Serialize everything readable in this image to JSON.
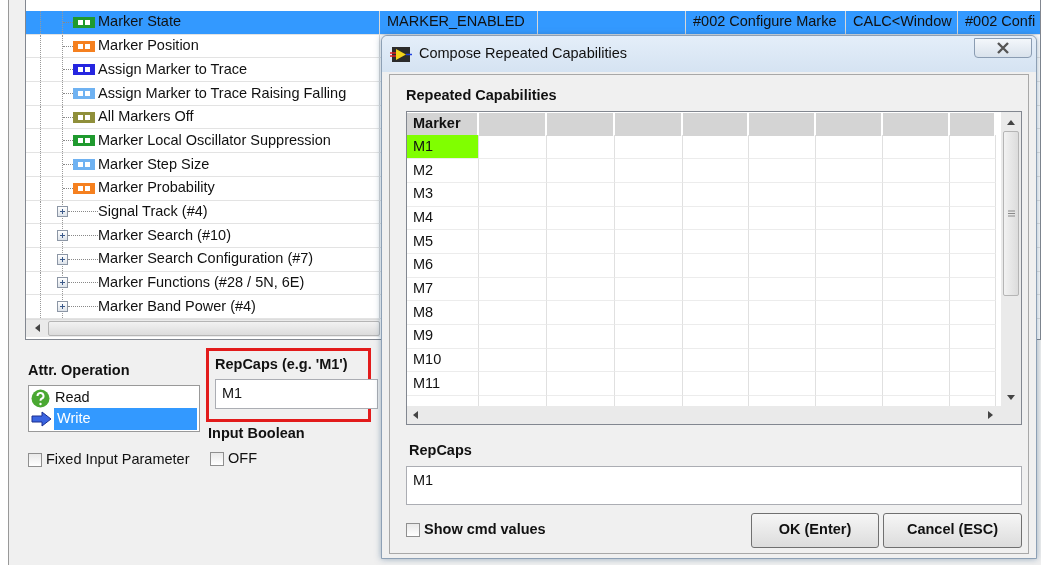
{
  "main": {
    "tree_rows": [
      {
        "label": "Marker State",
        "kind": "leaf",
        "color": "#1f9a2e",
        "selected": true,
        "cells": {
          "column_2": "MARKER_ENABLED",
          "column_4": "#002 Configure Marke",
          "column_5": "CALC<Window",
          "column_6": "#002 Confi"
        }
      },
      {
        "label": "Marker Position",
        "kind": "leaf",
        "color": "#f5801f",
        "selected": false
      },
      {
        "label": "Assign Marker to Trace",
        "kind": "leaf",
        "color": "#2626e0",
        "selected": false
      },
      {
        "label": "Assign Marker to Trace Raising Falling",
        "kind": "leaf",
        "color": "#6fb2f2",
        "selected": false
      },
      {
        "label": "All Markers Off",
        "kind": "leaf",
        "color": "#8f8f3a",
        "selected": false
      },
      {
        "label": "Marker Local Oscillator Suppression",
        "kind": "leaf",
        "color": "#1f9a2e",
        "selected": false
      },
      {
        "label": "Marker Step Size",
        "kind": "leaf",
        "color": "#6fb2f2",
        "selected": false
      },
      {
        "label": "Marker Probability",
        "kind": "leaf",
        "color": "#f5801f",
        "selected": false
      },
      {
        "label": "Signal Track (#4)",
        "kind": "group",
        "expanded": false,
        "selected": false
      },
      {
        "label": "Marker Search (#10)",
        "kind": "group",
        "expanded": false,
        "selected": false
      },
      {
        "label": "Marker Search Configuration (#7)",
        "kind": "group",
        "expanded": false,
        "selected": false
      },
      {
        "label": "Marker Functions (#28 / 5N, 6E)",
        "kind": "group",
        "expanded": false,
        "selected": false
      },
      {
        "label": "Marker Band Power (#4)",
        "kind": "group",
        "expanded": false,
        "selected": false
      }
    ],
    "attr_operation": {
      "label": "Attr. Operation",
      "items": [
        {
          "label": "Read",
          "kind": "read",
          "selected": false
        },
        {
          "label": "Write",
          "kind": "write",
          "selected": true
        }
      ]
    },
    "fixed_input": {
      "label": "Fixed Input Parameter",
      "checked": false
    },
    "repcaps": {
      "label": "RepCaps (e.g. 'M1')",
      "value": "M1"
    },
    "input_boolean": {
      "label": "Input Boolean",
      "checkbox_label": "OFF",
      "checked": false
    }
  },
  "dialog": {
    "title": "Compose Repeated Capabilities",
    "group_label": "Repeated Capabilities",
    "grid": {
      "column": "Marker",
      "rows": [
        {
          "label": "M1",
          "selected": true
        },
        {
          "label": "M2",
          "selected": false
        },
        {
          "label": "M3",
          "selected": false
        },
        {
          "label": "M4",
          "selected": false
        },
        {
          "label": "M5",
          "selected": false
        },
        {
          "label": "M6",
          "selected": false
        },
        {
          "label": "M7",
          "selected": false
        },
        {
          "label": "M8",
          "selected": false
        },
        {
          "label": "M9",
          "selected": false
        },
        {
          "label": "M10",
          "selected": false
        },
        {
          "label": "M11",
          "selected": false
        }
      ]
    },
    "repcaps": {
      "label": "RepCaps",
      "value": "M1"
    },
    "show_cmd": {
      "label": "Show cmd values",
      "checked": false
    },
    "buttons": [
      "OK (Enter)",
      "Cancel (ESC)"
    ]
  }
}
